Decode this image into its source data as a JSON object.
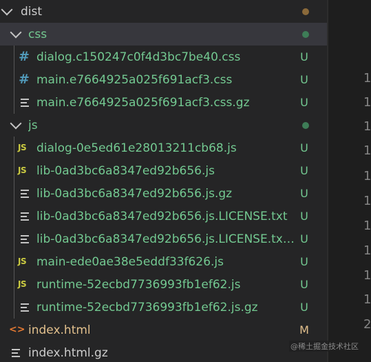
{
  "colors": {
    "untracked": "#73c991",
    "modified": "#e2c08d",
    "folder": "#cccccc",
    "dist_dot": "#8b6a3a",
    "css_dot": "#3e7d57",
    "js_dot": "#3e7d57"
  },
  "tree": {
    "dist": {
      "label": "dist"
    },
    "css": {
      "label": "css"
    },
    "css_files": [
      {
        "label": "dialog.c150247c0f4d3bc7be40.css",
        "icon": "css-hash-icon",
        "status": "U"
      },
      {
        "label": "main.e7664925a025f691acf3.css",
        "icon": "css-hash-icon",
        "status": "U"
      },
      {
        "label": "main.e7664925a025f691acf3.css.gz",
        "icon": "text-file-icon",
        "status": "U"
      }
    ],
    "js": {
      "label": "js"
    },
    "js_files": [
      {
        "label": "dialog-0e5ed61e28013211cb68.js",
        "icon": "js-icon",
        "status": "U"
      },
      {
        "label": "lib-0ad3bc6a8347ed92b656.js",
        "icon": "js-icon",
        "status": "U"
      },
      {
        "label": "lib-0ad3bc6a8347ed92b656.js.gz",
        "icon": "text-file-icon",
        "status": "U"
      },
      {
        "label": "lib-0ad3bc6a8347ed92b656.js.LICENSE.txt",
        "icon": "text-file-icon",
        "status": "U"
      },
      {
        "label": "lib-0ad3bc6a8347ed92b656.js.LICENSE.txt....",
        "icon": "text-file-icon",
        "status": "U"
      },
      {
        "label": "main-ede0ae38e5eddf33f626.js",
        "icon": "js-icon",
        "status": "U"
      },
      {
        "label": "runtime-52ecbd7736993fb1ef62.js",
        "icon": "js-icon",
        "status": "U"
      },
      {
        "label": "runtime-52ecbd7736993fb1ef62.js.gz",
        "icon": "text-file-icon",
        "status": "U"
      }
    ],
    "root_files": [
      {
        "label": "index.html",
        "icon": "html-icon",
        "status": "M"
      },
      {
        "label": "index.html.gz",
        "icon": "text-file-icon",
        "status": ""
      }
    ]
  },
  "icons": {
    "css_glyph": "#",
    "js_glyph": "JS",
    "html_glyph": "<>"
  },
  "gutter": {
    "line_numbers": [
      "1",
      "1",
      "1",
      "1",
      "1",
      "1",
      "1",
      "1",
      "1",
      "1",
      "1",
      "2"
    ]
  },
  "watermark": "@稀土掘金技术社区"
}
